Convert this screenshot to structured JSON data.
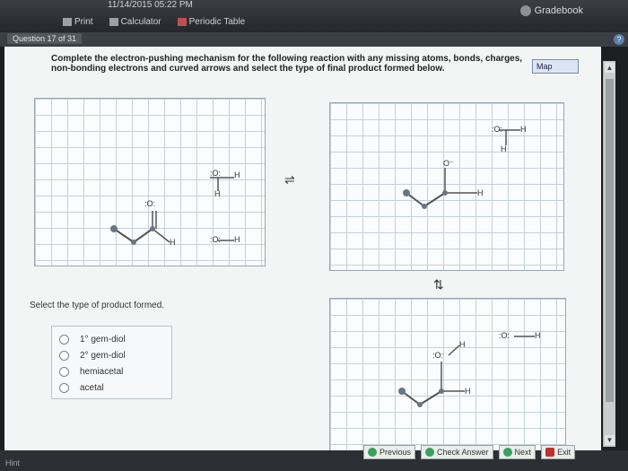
{
  "topbar": {
    "stats": "11/14/2015 05:22 PM",
    "gradebook": "Gradebook",
    "tools": {
      "print": "Print",
      "calculator": "Calculator",
      "periodic_table": "Periodic Table"
    }
  },
  "question": {
    "label": "Question 17 of 31"
  },
  "instruction": "Complete the electron-pushing mechanism for the following reaction with any missing atoms, bonds, charges, non-bonding electrons and curved arrows and select the type of final product formed below.",
  "map_button": "Map",
  "equilibrium_symbol": "⇌",
  "reverse_symbol": "⇅",
  "atoms": {
    "oxygen": "O",
    "hydrogen": "H",
    "oxygen_neg": "O⁻",
    "oxygen_lp": ":O:",
    "dots": "··"
  },
  "select_prompt": "Select the type of product formed.",
  "choices": [
    "1° gem-diol",
    "2° gem-diol",
    "hemiacetal",
    "acetal"
  ],
  "nav": {
    "previous": "Previous",
    "check_answer": "Check Answer",
    "next": "Next",
    "exit": "Exit"
  },
  "hint": "Hint"
}
